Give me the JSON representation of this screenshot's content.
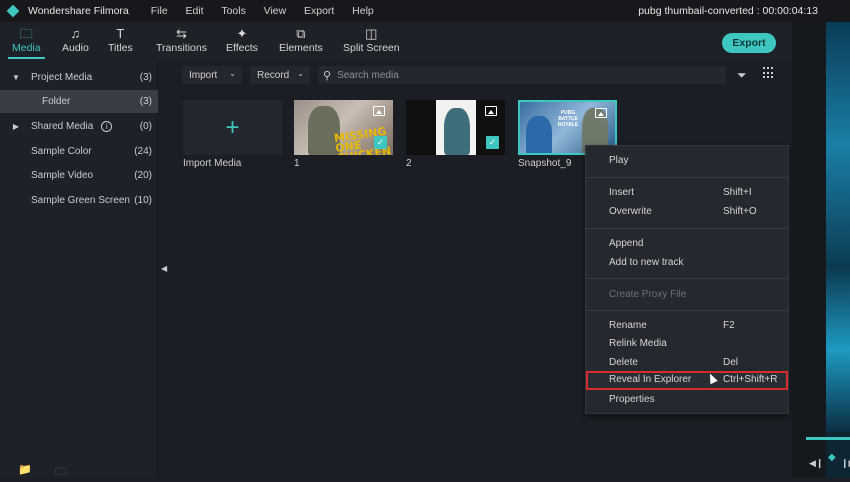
{
  "app": {
    "name": "Wondershare Filmora",
    "project_title": "pubg thumbail-converted : 00:00:04:13"
  },
  "menu": [
    "File",
    "Edit",
    "Tools",
    "View",
    "Export",
    "Help"
  ],
  "toolbar": {
    "tabs": [
      {
        "label": "Media",
        "icon": "folder-icon",
        "active": true
      },
      {
        "label": "Audio",
        "icon": "music-note-icon",
        "active": false
      },
      {
        "label": "Titles",
        "icon": "text-t-icon",
        "active": false
      },
      {
        "label": "Transitions",
        "icon": "transition-icon",
        "active": false
      },
      {
        "label": "Effects",
        "icon": "effects-icon",
        "active": false
      },
      {
        "label": "Elements",
        "icon": "elements-icon",
        "active": false
      },
      {
        "label": "Split Screen",
        "icon": "split-screen-icon",
        "active": false
      }
    ],
    "export_label": "Export"
  },
  "sidebar": {
    "items": [
      {
        "label": "Project Media",
        "count": "(3)",
        "expanded": true
      },
      {
        "label": "Folder",
        "count": "(3)",
        "selected": true
      },
      {
        "label": "Shared Media",
        "count": "(0)",
        "expanded": false
      },
      {
        "label": "Sample Color",
        "count": "(24)"
      },
      {
        "label": "Sample Video",
        "count": "(20)"
      },
      {
        "label": "Sample Green Screen",
        "count": "(10)"
      }
    ]
  },
  "media_toolbar": {
    "import_label": "Import",
    "record_label": "Record",
    "search_placeholder": "Search media"
  },
  "media": [
    {
      "label": "Import Media",
      "type": "import"
    },
    {
      "label": "1",
      "type": "image",
      "checked": true,
      "thumb_text": "MISSING ONE CHICKEN DINNER?"
    },
    {
      "label": "2",
      "type": "image",
      "checked": true
    },
    {
      "label": "Snapshot_9",
      "type": "image",
      "selected": true,
      "thumb_text": "PUBG BATTLE ROYALE"
    }
  ],
  "context_menu": {
    "items": [
      {
        "label": "Play",
        "shortcut": ""
      },
      {
        "label": "Insert",
        "shortcut": "Shift+I"
      },
      {
        "label": "Overwrite",
        "shortcut": "Shift+O"
      },
      {
        "label": "Append",
        "shortcut": ""
      },
      {
        "label": "Add to new track",
        "shortcut": ""
      },
      {
        "label": "Create Proxy File",
        "shortcut": "",
        "disabled": true
      },
      {
        "label": "Rename",
        "shortcut": "F2"
      },
      {
        "label": "Relink Media",
        "shortcut": ""
      },
      {
        "label": "Delete",
        "shortcut": "Del"
      },
      {
        "label": "Reveal In Explorer",
        "shortcut": "Ctrl+Shift+R",
        "highlighted": true
      },
      {
        "label": "Properties",
        "shortcut": ""
      }
    ]
  },
  "colors": {
    "accent": "#3ec7c0",
    "highlight_border": "#d82b2b",
    "background": "#1b1e24"
  }
}
